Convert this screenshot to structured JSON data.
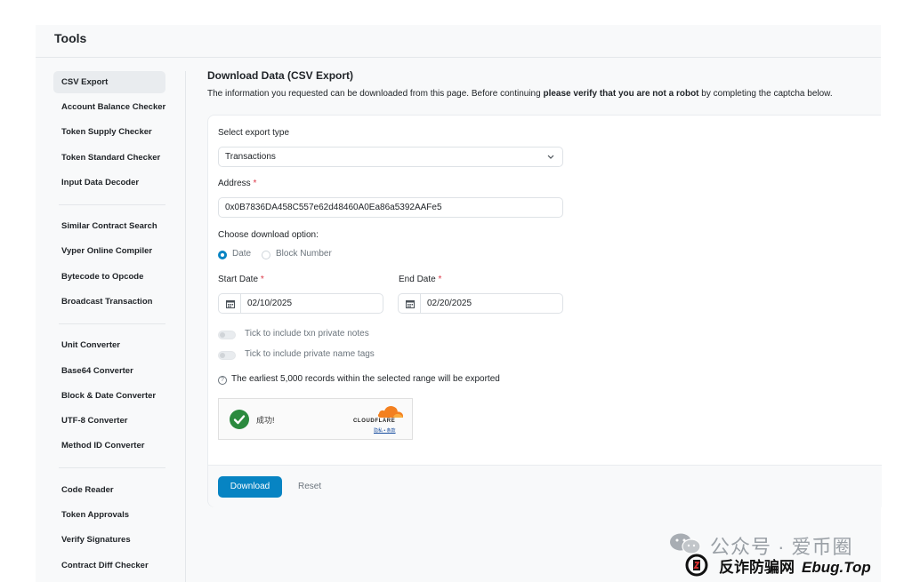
{
  "header": {
    "title": "Tools"
  },
  "sidebar": {
    "groups": [
      [
        "CSV Export",
        "Account Balance Checker",
        "Token Supply Checker",
        "Token Standard Checker",
        "Input Data Decoder"
      ],
      [
        "Similar Contract Search",
        "Vyper Online Compiler",
        "Bytecode to Opcode",
        "Broadcast Transaction"
      ],
      [
        "Unit Converter",
        "Base64 Converter",
        "Block & Date Converter",
        "UTF-8 Converter",
        "Method ID Converter"
      ],
      [
        "Code Reader",
        "Token Approvals",
        "Verify Signatures",
        "Contract Diff Checker"
      ]
    ],
    "active": "CSV Export"
  },
  "main": {
    "heading": "Download Data (CSV Export)",
    "intro_pre": "The information you requested can be downloaded from this page. Before continuing ",
    "intro_bold": "please verify that you are not a robot",
    "intro_post": " by completing the captcha below."
  },
  "form": {
    "export_type_label": "Select export type",
    "export_type_value": "Transactions",
    "address_label": "Address",
    "address_value": "0x0B7836DA458C557e62d48460A0Ea86a5392AAFe5",
    "required_mark": "*",
    "download_option_label": "Choose download option:",
    "option_date": "Date",
    "option_block": "Block Number",
    "selected_option": "Date",
    "start_date_label": "Start Date",
    "start_date_value": "02/10/2025",
    "end_date_label": "End Date",
    "end_date_value": "02/20/2025",
    "tick_txn_notes": "Tick to include txn private notes",
    "tick_name_tags": "Tick to include private name tags",
    "note_icon": "?",
    "note": "The earliest 5,000 records within the selected range will be exported",
    "download_button": "Download",
    "reset_button": "Reset"
  },
  "captcha": {
    "status": "成功!",
    "brand": "CLOUDFLARE",
    "links": "隐私 • 条款"
  },
  "watermark": {
    "top": "公众号 · 爱币圈",
    "site": "反诈防骗网",
    "domain": "Ebug.Top"
  },
  "colors": {
    "accent": "#0784c3",
    "required": "#dc3545",
    "success": "#2b8a3e",
    "cloudflare": "#f38020"
  }
}
